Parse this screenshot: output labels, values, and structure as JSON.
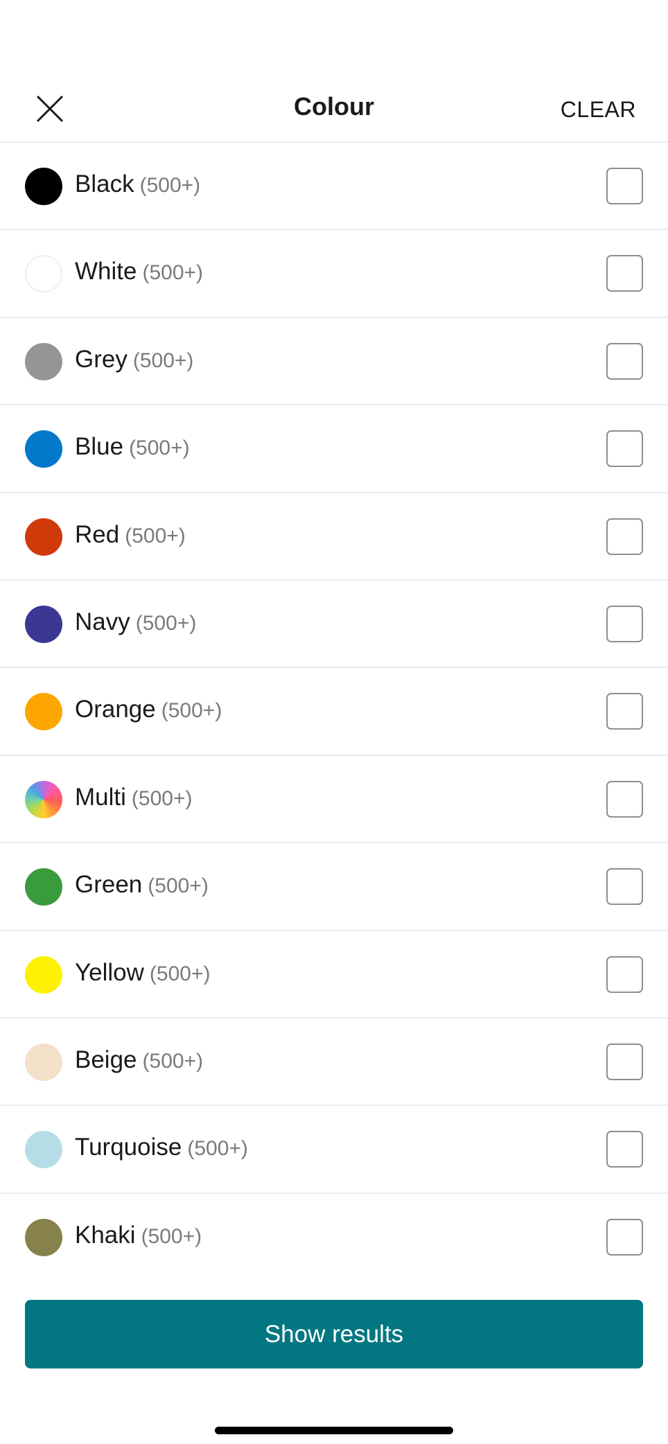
{
  "header": {
    "close_icon": "close-icon",
    "title": "Colour",
    "clear_label": "CLEAR"
  },
  "colours": [
    {
      "name": "Black",
      "count": "(500+)",
      "swatch": "#000000",
      "checked": false
    },
    {
      "name": "White",
      "count": "(500+)",
      "swatch": "#ffffff",
      "checked": false
    },
    {
      "name": "Grey",
      "count": "(500+)",
      "swatch": "#959595",
      "checked": false
    },
    {
      "name": "Blue",
      "count": "(500+)",
      "swatch": "#0179c8",
      "checked": false
    },
    {
      "name": "Red",
      "count": "(500+)",
      "swatch": "#d03a0a",
      "checked": false
    },
    {
      "name": "Navy",
      "count": "(500+)",
      "swatch": "#3a3893",
      "checked": false
    },
    {
      "name": "Orange",
      "count": "(500+)",
      "swatch": "#fda501",
      "checked": false
    },
    {
      "name": "Multi",
      "count": "(500+)",
      "swatch": "multi",
      "checked": false
    },
    {
      "name": "Green",
      "count": "(500+)",
      "swatch": "#3a9b3d",
      "checked": false
    },
    {
      "name": "Yellow",
      "count": "(500+)",
      "swatch": "#fef101",
      "checked": false
    },
    {
      "name": "Beige",
      "count": "(500+)",
      "swatch": "#f3e0c8",
      "checked": false
    },
    {
      "name": "Turquoise",
      "count": "(500+)",
      "swatch": "#b6dde6",
      "checked": false
    },
    {
      "name": "Khaki",
      "count": "(500+)",
      "swatch": "#87814b",
      "checked": false
    }
  ],
  "footer": {
    "show_results_label": "Show results",
    "accent_color": "#037781"
  }
}
